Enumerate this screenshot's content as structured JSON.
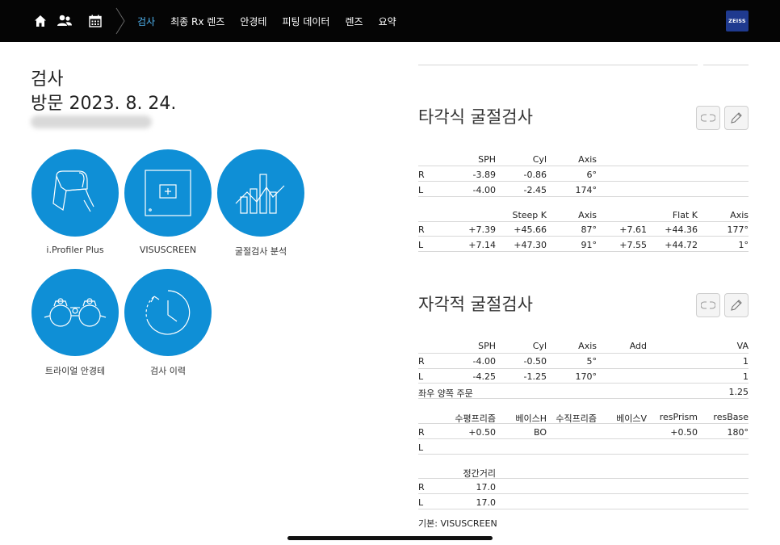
{
  "nav": {
    "tabs": [
      {
        "label": "검사",
        "active": true
      },
      {
        "label": "최종 Rx 렌즈",
        "active": false
      },
      {
        "label": "안경테",
        "active": false
      },
      {
        "label": "피팅 데이터",
        "active": false
      },
      {
        "label": "렌즈",
        "active": false
      },
      {
        "label": "요약",
        "active": false
      }
    ],
    "brand": "ZEISS",
    "icons": [
      "home-icon",
      "users-icon",
      "calendar-icon"
    ]
  },
  "header": {
    "title": "검사",
    "visit": "방문 2023. 8. 24."
  },
  "tiles": [
    {
      "label": "i.Profiler Plus",
      "icon": "iprofiler-device-icon"
    },
    {
      "label": "VISUSCREEN",
      "icon": "visuscreen-icon"
    },
    {
      "label": "굴절검사 분석",
      "icon": "analysis-chart-icon"
    },
    {
      "label": "트라이얼 안경테",
      "icon": "trial-frame-icon"
    },
    {
      "label": "검사 이력",
      "icon": "history-clock-icon"
    }
  ],
  "objective": {
    "title": "타각식 굴절검사",
    "rx_headers": [
      "SPH",
      "Cyl",
      "Axis"
    ],
    "rx_rows": [
      {
        "eye": "R",
        "sph": "-3.89",
        "cyl": "-0.86",
        "axis": "6°"
      },
      {
        "eye": "L",
        "sph": "-4.00",
        "cyl": "-2.45",
        "axis": "174°"
      }
    ],
    "k_headers": [
      "Steep K",
      "Axis",
      "Flat K",
      "Axis"
    ],
    "k_rows": [
      {
        "eye": "R",
        "v1": "+7.39",
        "steep": "+45.66",
        "axis1": "87°",
        "v2": "+7.61",
        "flat": "+44.36",
        "axis2": "177°"
      },
      {
        "eye": "L",
        "v1": "+7.14",
        "steep": "+47.30",
        "axis1": "91°",
        "v2": "+7.55",
        "flat": "+44.72",
        "axis2": "1°"
      }
    ]
  },
  "subjective": {
    "title": "자각적 굴절검사",
    "rx_headers": [
      "SPH",
      "Cyl",
      "Axis",
      "Add",
      "VA"
    ],
    "rx_rows": [
      {
        "eye": "R",
        "sph": "-4.00",
        "cyl": "-0.50",
        "axis": "5°",
        "add": "",
        "va": "1"
      },
      {
        "eye": "L",
        "sph": "-4.25",
        "cyl": "-1.25",
        "axis": "170°",
        "add": "",
        "va": "1"
      }
    ],
    "binocular_label": "좌우 양쪽 주문",
    "binocular_va": "1.25",
    "prism_headers": [
      "수평프리즘",
      "베이스H",
      "수직프리즘",
      "베이스V",
      "resPrism",
      "resBase"
    ],
    "prism_rows": [
      {
        "eye": "R",
        "h": "+0.50",
        "bh": "BO",
        "v": "",
        "bv": "",
        "res": "+0.50",
        "rb": "180°"
      },
      {
        "eye": "L",
        "h": "",
        "bh": "",
        "v": "",
        "bv": "",
        "res": "",
        "rb": ""
      }
    ],
    "vd_header": "정간거리",
    "vd_rows": [
      {
        "eye": "R",
        "value": "17.0"
      },
      {
        "eye": "L",
        "value": "17.0"
      }
    ],
    "source": "기본: VISUSCREEN"
  }
}
